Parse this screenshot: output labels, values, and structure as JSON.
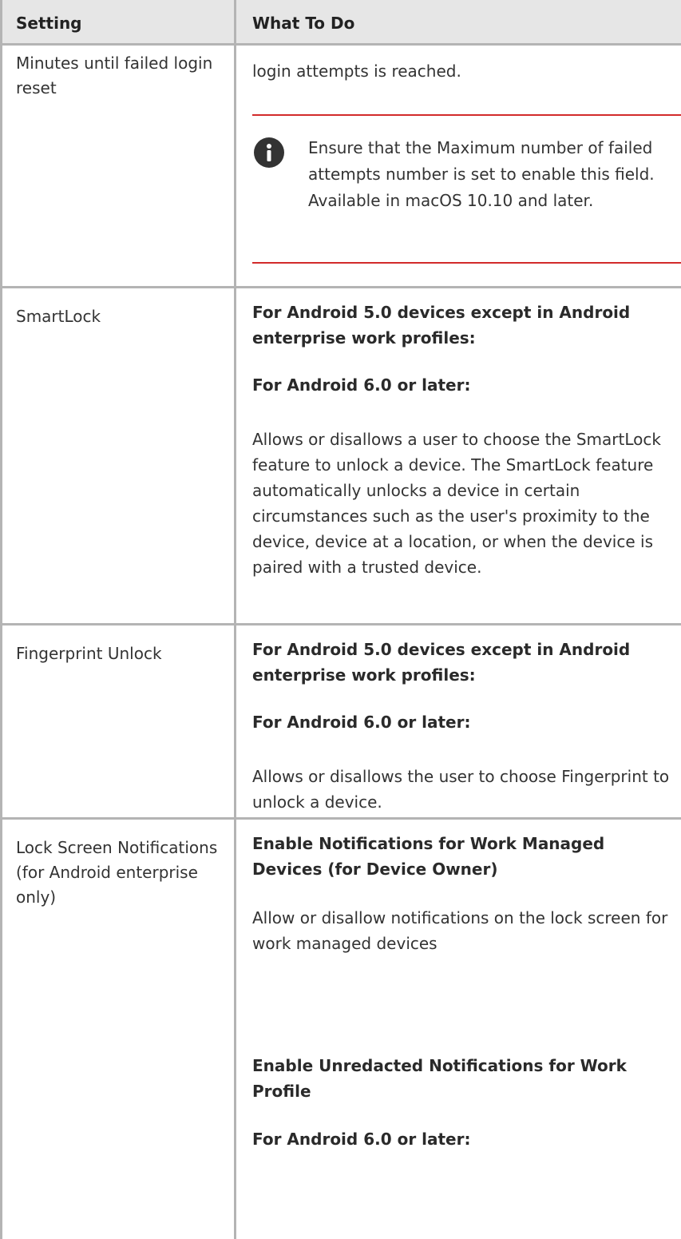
{
  "header": {
    "setting": "Setting",
    "what_to_do": "What To Do"
  },
  "rows": [
    {
      "setting": "Minutes until failed login reset",
      "text": "login attempts is reached.",
      "note": {
        "icon": "info-icon",
        "text": "Ensure that the Maximum number of failed attempts number is set to enable this field. Available in macOS 10.10 and later."
      }
    },
    {
      "setting": "SmartLock",
      "bold1": "For Android 5.0 devices except in Android enterprise work profiles:",
      "bold2": "For Android 6.0 or later:",
      "text": "Allows or disallows a user to choose the SmartLock feature to unlock a device. The SmartLock feature automatically unlocks a device in certain circumstances such as the user's proximity to the device, device at a location, or when the device is paired with a trusted device."
    },
    {
      "setting": "Fingerprint Unlock",
      "bold1": "For Android 5.0 devices except in Android enterprise work profiles:",
      "bold2": "For Android 6.0 or later:",
      "text": "Allows or disallows the user to choose Fingerprint to unlock a device."
    },
    {
      "setting": "Lock Screen Notifications (for Android enterprise only)",
      "bold1": "Enable Notifications for Work Managed Devices (for Device Owner)",
      "text": "Allow or disallow notifications on the lock screen for work managed devices",
      "bold2": "Enable Unredacted Notifications for Work Profile",
      "bold3": "For Android 6.0 or later:"
    }
  ],
  "colors": {
    "header_bg": "#e6e6e6",
    "border": "#b4b4b4",
    "note_rule": "#d22b2b",
    "text": "#333333"
  }
}
